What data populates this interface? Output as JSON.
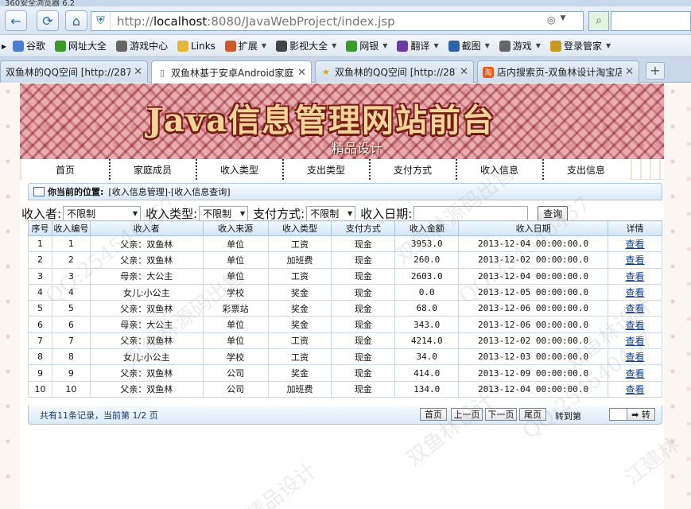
{
  "browser": {
    "window_title": "360安全浏览器 6.2",
    "url_prefix": "http://",
    "url_host": "localhost",
    "url_rest": ":8080/JavaWebProject/index.jsp",
    "favorites": [
      {
        "label": "谷歌",
        "icon": "google-icon",
        "color": "#4a7fd4"
      },
      {
        "label": "网址大全",
        "icon": "plus-circle-icon",
        "color": "#3a9b2a"
      },
      {
        "label": "游戏中心",
        "icon": "gamepad-icon",
        "color": "#666666"
      },
      {
        "label": "Links",
        "icon": "folder-icon",
        "color": "#e6b63a"
      },
      {
        "label": "扩展",
        "icon": "grid-icon",
        "color": "#d05a2a"
      },
      {
        "label": "影视大全",
        "icon": "play-icon",
        "color": "#444444"
      },
      {
        "label": "网银",
        "icon": "shield-icon",
        "color": "#3a9b2a"
      },
      {
        "label": "翻译",
        "icon": "translate-icon",
        "color": "#6a3aa8"
      },
      {
        "label": "截图",
        "icon": "screenshot-icon",
        "color": "#2b64a8"
      },
      {
        "label": "游戏",
        "icon": "gamepad-icon",
        "color": "#666666"
      },
      {
        "label": "登录管家",
        "icon": "key-icon",
        "color": "#c89a20"
      }
    ],
    "tabs": [
      {
        "label": "双鱼林的QQ空间 [http://287",
        "icon": "star-icon",
        "active": false
      },
      {
        "label": "双鱼林基于安卓Android家庭",
        "icon": "page-icon",
        "active": true
      },
      {
        "label": "双鱼林的QQ空间 [http://287",
        "icon": "star-icon",
        "active": false
      },
      {
        "label": "店内搜索页-双鱼林设计淘宝店",
        "icon": "taobao-icon",
        "active": false
      }
    ],
    "new_tab": "+"
  },
  "site": {
    "title": "Java信息管理网站前台",
    "subtitle": "精品设计",
    "menu": [
      "首页",
      "家庭成员",
      "收入类型",
      "支出类型",
      "支付方式",
      "收入信息",
      "支出信息"
    ]
  },
  "location": {
    "label": "你当前的位置:",
    "path": "[收入信息管理]-[收入信息查询]"
  },
  "filter": {
    "income_person_label": "收入者:",
    "income_person_value": "不限制",
    "income_type_label": "收入类型:",
    "income_type_value": "不限制",
    "payment_label": "支付方式:",
    "payment_value": "不限制",
    "date_label": "收入日期:",
    "date_value": "",
    "query_button": "查询"
  },
  "table": {
    "headers": [
      "序号",
      "收入编号",
      "收入者",
      "收入来源",
      "收入类型",
      "支付方式",
      "收入金额",
      "收入日期",
      "详情"
    ],
    "rows": [
      [
        "1",
        "1",
        "父亲：双鱼林",
        "单位",
        "工资",
        "现金",
        "3953.0",
        "2013-12-04 00:00:00.0",
        "查看"
      ],
      [
        "2",
        "2",
        "父亲：双鱼林",
        "单位",
        "加班费",
        "现金",
        "260.0",
        "2013-12-02 00:00:00.0",
        "查看"
      ],
      [
        "3",
        "3",
        "母亲：大公主",
        "单位",
        "工资",
        "现金",
        "2603.0",
        "2013-12-04 00:00:00.0",
        "查看"
      ],
      [
        "4",
        "4",
        "女儿:小公主",
        "学校",
        "奖金",
        "现金",
        "0.0",
        "2013-12-05 00:00:00.0",
        "查看"
      ],
      [
        "5",
        "5",
        "父亲：双鱼林",
        "彩票站",
        "奖金",
        "现金",
        "68.0",
        "2013-12-06 00:00:00.0",
        "查看"
      ],
      [
        "6",
        "6",
        "母亲：大公主",
        "单位",
        "奖金",
        "现金",
        "343.0",
        "2013-12-06 00:00:00.0",
        "查看"
      ],
      [
        "7",
        "7",
        "父亲：双鱼林",
        "单位",
        "工资",
        "现金",
        "4214.0",
        "2013-12-02 00:00:00.0",
        "查看"
      ],
      [
        "8",
        "8",
        "女儿:小公主",
        "学校",
        "工资",
        "现金",
        "34.0",
        "2013-12-03 00:00:00.0",
        "查看"
      ],
      [
        "9",
        "9",
        "父亲：双鱼林",
        "公司",
        "奖金",
        "现金",
        "414.0",
        "2013-12-09 00:00:00.0",
        "查看"
      ],
      [
        "10",
        "10",
        "父亲：双鱼林",
        "公司",
        "加班费",
        "现金",
        "134.0",
        "2013-12-04 00:00:00.0",
        "查看"
      ]
    ]
  },
  "pager": {
    "info": "共有11条记录，当前第 1/2 页",
    "first": "首页",
    "prev": "上一页",
    "next": "下一页",
    "last": "尾页",
    "jump_label": "转到第",
    "page_unit": "页",
    "go": "➡ 转"
  },
  "watermarks": [
    "双鱼林源码出售",
    "QQ:254540457",
    "双鱼林设计",
    "精品设计",
    "QQ:254540457",
    "江建林",
    "双鱼林源码出售",
    "QQ:254540457",
    "双鱼林设计"
  ]
}
